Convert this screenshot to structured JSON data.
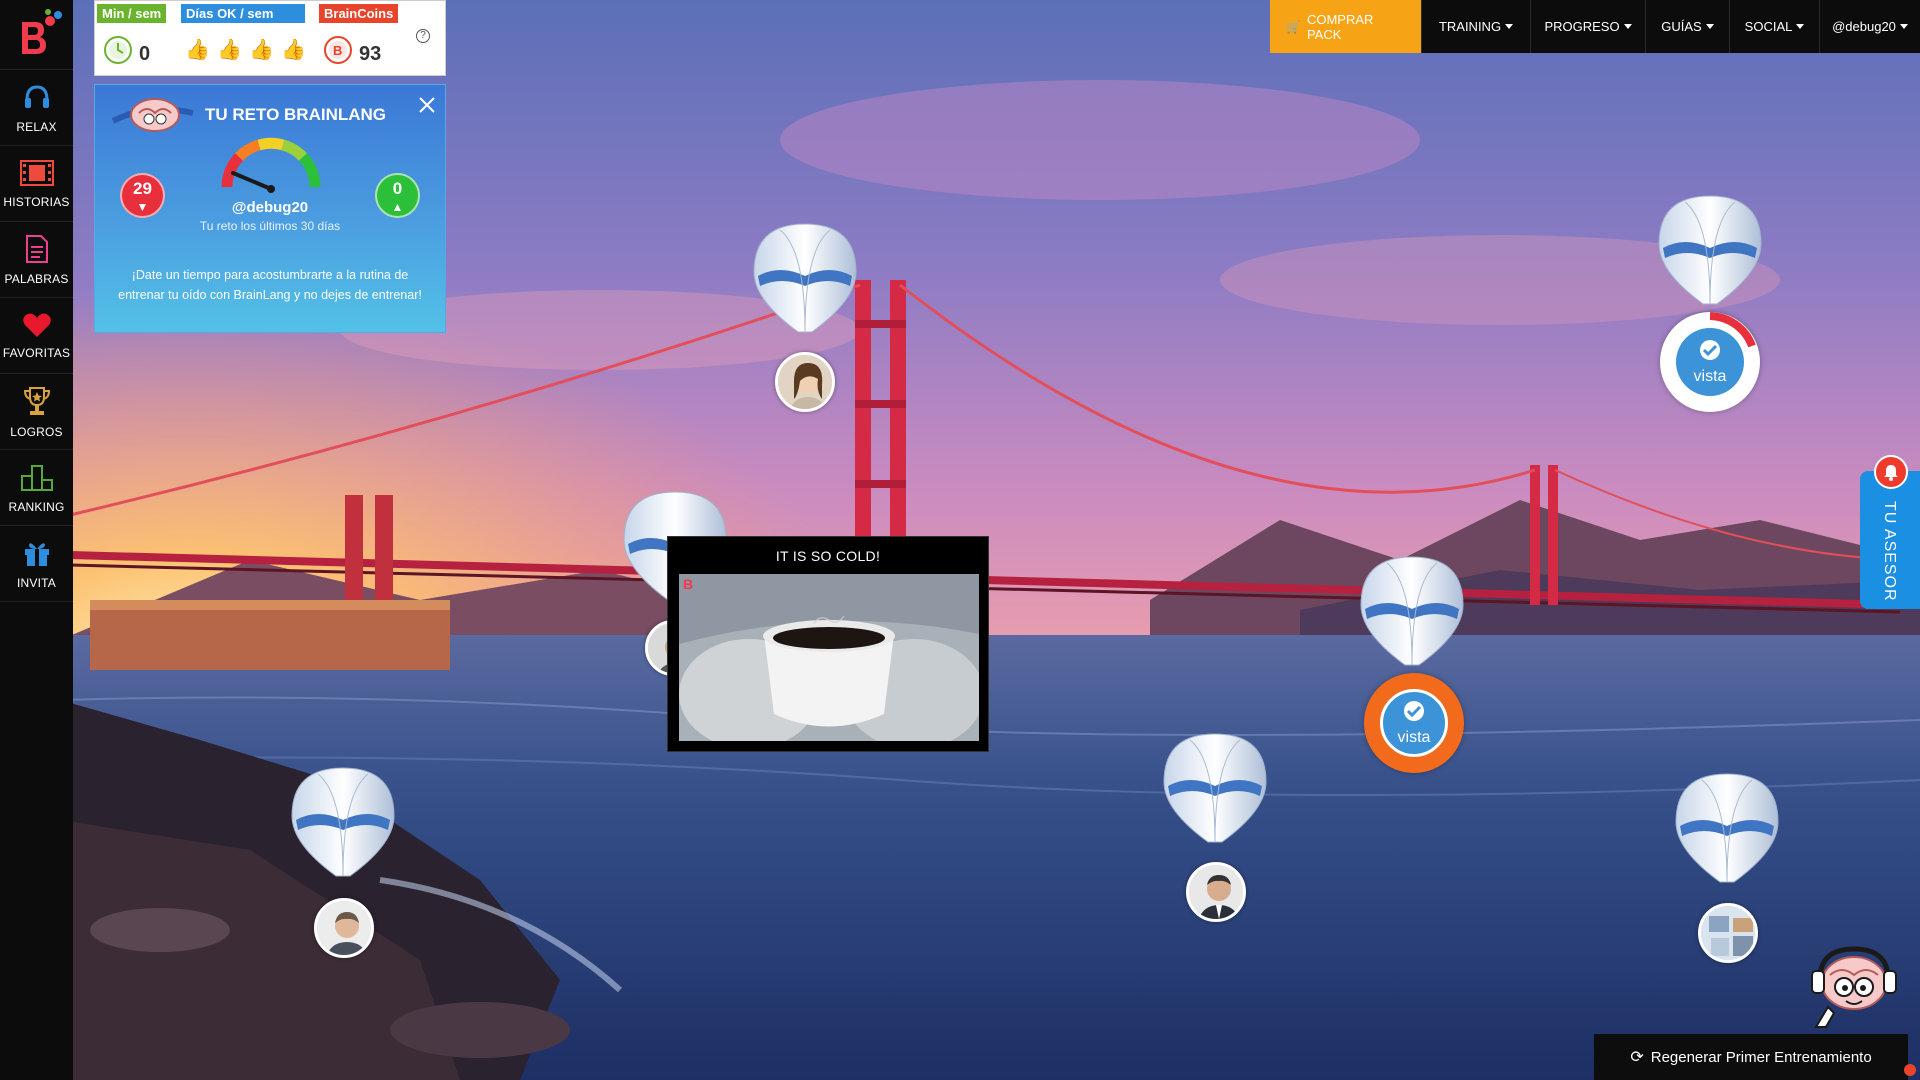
{
  "sidebar": {
    "items": [
      {
        "label": "RELAX",
        "icon": "headphones-icon"
      },
      {
        "label": "HISTORIAS",
        "icon": "film-icon"
      },
      {
        "label": "PALABRAS",
        "icon": "document-icon"
      },
      {
        "label": "FAVORITAS",
        "icon": "heart-icon"
      },
      {
        "label": "LOGROS",
        "icon": "trophy-icon"
      },
      {
        "label": "RANKING",
        "icon": "podium-icon"
      },
      {
        "label": "INVITA",
        "icon": "gift-icon"
      }
    ]
  },
  "stats": {
    "min_week": {
      "label": "Min / sem",
      "value": "0",
      "color": "#6ab42d"
    },
    "days_ok": {
      "label": "Días OK / sem",
      "color": "#2e8ede"
    },
    "braincoins": {
      "label": "BrainCoins",
      "value": "93",
      "color": "#e8442c"
    },
    "help": "?"
  },
  "challenge": {
    "title": "TU RETO BRAINLANG",
    "negative": "29",
    "positive": "0",
    "username": "@debug20",
    "subtitle": "Tu reto los últimos 30 días",
    "message": "¡Date un tiempo para acostumbrarte a la rutina de entrenar tu oído con BrainLang y no dejes de entrenar!"
  },
  "nav": {
    "buy": "COMPRAR PACK",
    "items": [
      "TRAINING",
      "PROGRESO",
      "GUÍAS",
      "SOCIAL",
      "@debug20"
    ]
  },
  "balloons": {
    "done_label": "vista"
  },
  "video": {
    "title": "IT IS SO COLD!"
  },
  "advisor": {
    "label": "TU ASESOR"
  },
  "regenerate": {
    "label": "Regenerar Primer Entrenamiento"
  },
  "colors": {
    "accent_orange": "#f7a316",
    "advisor_blue": "#1b8fe1",
    "done_ring_orange": "#f26a1b"
  }
}
